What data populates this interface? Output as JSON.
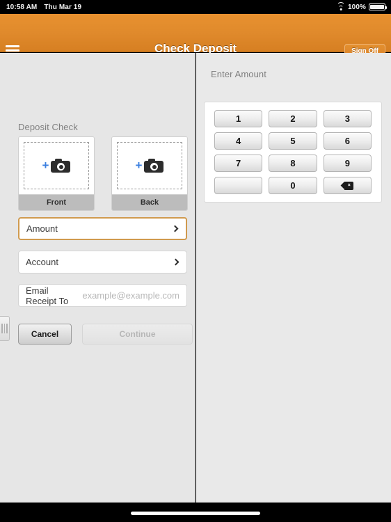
{
  "status_bar": {
    "time": "10:58 AM",
    "date": "Thu Mar 19",
    "wifi_icon": "wifi-icon",
    "battery_percent": "100%",
    "battery_icon": "battery-icon"
  },
  "nav_bar": {
    "menu_icon": "hamburger-menu-icon",
    "title": "Check Deposit",
    "sign_off_label": "Sign Off",
    "background_color": "#e08a2c"
  },
  "left_pane": {
    "section_title": "Deposit Check",
    "capture_cards": [
      {
        "label": "Front",
        "plus_icon": "plus-icon",
        "camera_icon": "camera-icon"
      },
      {
        "label": "Back",
        "plus_icon": "plus-icon",
        "camera_icon": "camera-icon"
      }
    ],
    "fields": [
      {
        "label": "Amount",
        "value": "",
        "focused": true,
        "accessory_icon": "chevron-right-icon"
      },
      {
        "label": "Account",
        "value": "",
        "focused": false,
        "accessory_icon": "chevron-right-icon"
      }
    ],
    "email_row": {
      "label": "Email Receipt To",
      "value": "",
      "placeholder": "example@example.com"
    },
    "buttons": {
      "cancel_label": "Cancel",
      "continue_label": "Continue",
      "continue_disabled": true
    },
    "drag_handle": "split-view-drag-handle",
    "focus_border_color": "#d09a4e"
  },
  "right_pane": {
    "section_title": "Enter Amount",
    "keypad": [
      {
        "label": "1",
        "name": "key-1"
      },
      {
        "label": "2",
        "name": "key-2"
      },
      {
        "label": "3",
        "name": "key-3"
      },
      {
        "label": "4",
        "name": "key-4"
      },
      {
        "label": "5",
        "name": "key-5"
      },
      {
        "label": "6",
        "name": "key-6"
      },
      {
        "label": "7",
        "name": "key-7"
      },
      {
        "label": "8",
        "name": "key-8"
      },
      {
        "label": "9",
        "name": "key-9"
      },
      {
        "label": "",
        "name": "key-blank"
      },
      {
        "label": "0",
        "name": "key-0"
      },
      {
        "label": "",
        "name": "key-backspace",
        "icon": "backspace-icon"
      }
    ]
  },
  "home_indicator": "home-indicator"
}
